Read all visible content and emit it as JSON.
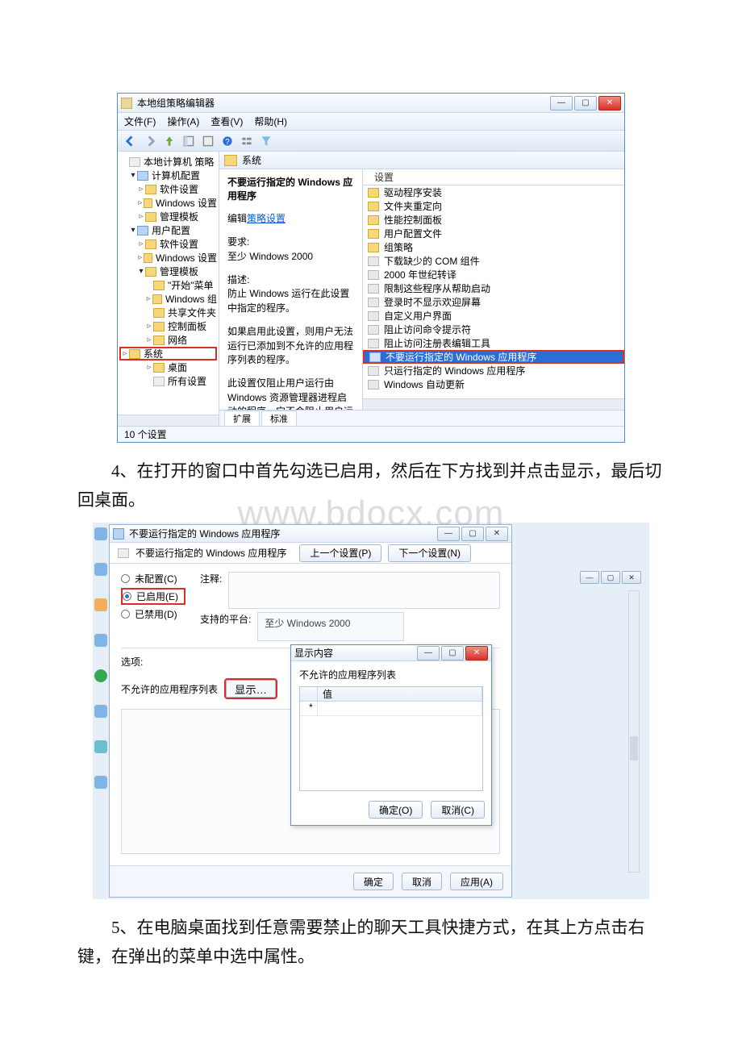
{
  "win1": {
    "title": "本地组策略编辑器",
    "menus": {
      "file": "文件(F)",
      "action": "操作(A)",
      "view": "查看(V)",
      "help": "帮助(H)"
    },
    "tree": {
      "root": "本地计算机 策略",
      "comp": "计算机配置",
      "c_soft": "软件设置",
      "c_win": "Windows 设置",
      "c_tpl": "管理模板",
      "user": "用户配置",
      "u_soft": "软件设置",
      "u_win": "Windows 设置",
      "u_tpl": "管理模板",
      "start": "\"开始\"菜单",
      "wcomp": "Windows 组",
      "share": "共享文件夹",
      "cpanel": "控制面板",
      "net": "网络",
      "sys": "系统",
      "desk": "桌面",
      "all": "所有设置"
    },
    "heading": "系统",
    "settings_label": "设置",
    "desc": {
      "title": "不要运行指定的 Windows 应用程序",
      "edit": "编辑",
      "edit_link": "策略设置",
      "req_label": "要求:",
      "req_value": "至少 Windows 2000",
      "desc_label": "描述:",
      "p1": "防止 Windows 运行在此设置中指定的程序。",
      "p2": "如果启用此设置，则用户无法运行已添加到不允许的应用程序列表的程序。",
      "p3": "此设置仅阻止用户运行由 Windows 资源管理器进程启动的程序。它不会阻止用户运行由系统进程或其他进程启动的程序，如任务管理器。另外，如果允许用户使用命令提示符(Cmd.exe)，则此设"
    },
    "list": {
      "i0": "驱动程序安装",
      "i1": "文件夹重定向",
      "i2": "性能控制面板",
      "i3": "用户配置文件",
      "i4": "组策略",
      "i5": "下载缺少的 COM 组件",
      "i6": "2000 年世纪转译",
      "i7": "限制这些程序从帮助启动",
      "i8": "登录时不显示欢迎屏幕",
      "i9": "自定义用户界面",
      "i10": "阻止访问命令提示符",
      "i11": "阻止访问注册表编辑工具",
      "i12": "不要运行指定的 Windows 应用程序",
      "i13": "只运行指定的 Windows 应用程序",
      "i14": "Windows 自动更新"
    },
    "tabs": {
      "ext": "扩展",
      "std": "标准"
    },
    "status": "10 个设置"
  },
  "para1": "　　4、在打开的窗口中首先勾选已启用，然后在下方找到并点击显示，最后切回桌面。",
  "watermark": "www.bdocx.com",
  "win2": {
    "title": "不要运行指定的 Windows 应用程序",
    "subtitle": "不要运行指定的 Windows 应用程序",
    "prev": "上一个设置(P)",
    "next": "下一个设置(N)",
    "r_not": "未配置(C)",
    "r_on": "已启用(E)",
    "r_off": "已禁用(D)",
    "comment_label": "注释:",
    "support_label": "支持的平台:",
    "support_value": "至少 Windows 2000",
    "options_label": "选项:",
    "list_label": "不允许的应用程序列表",
    "show_btn": "显示…",
    "ok": "确定",
    "cancel": "取消",
    "apply": "应用(A)"
  },
  "modal": {
    "title": "显示内容",
    "list_title": "不允许的应用程序列表",
    "col_value": "值",
    "star": "*",
    "ok": "确定(O)",
    "cancel": "取消(C)"
  },
  "para2": "　　5、在电脑桌面找到任意需要禁止的聊天工具快捷方式，在其上方点击右键，在弹出的菜单中选中属性。"
}
